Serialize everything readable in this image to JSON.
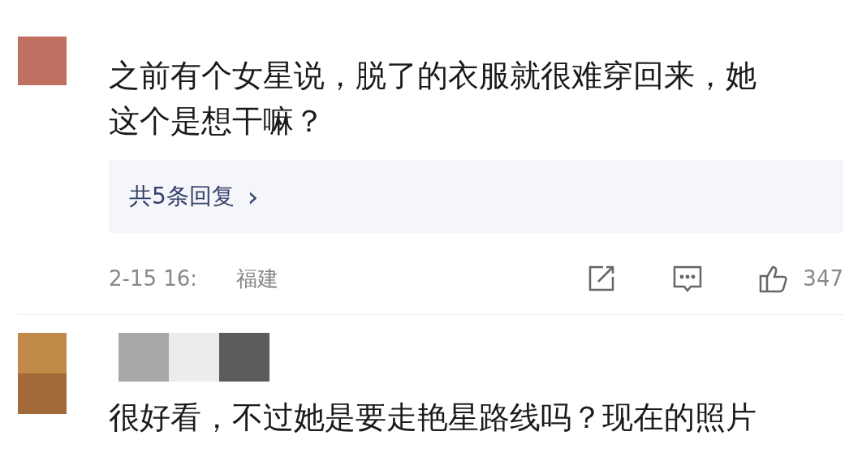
{
  "comments": [
    {
      "kind": "full",
      "color": "#c07060",
      "text": "之前有个女星说，脱了的衣服就很难穿回来，她这个是想干嘛？",
      "replies_link": "共5条回复",
      "replies_chevron": "›",
      "time": "2-15 16:",
      "location": "福建",
      "likes": "347"
    },
    {
      "kind": "partial",
      "color": "#c08a48",
      "text": "很好看，不过她是要走艳星路线吗？现在的照片"
    }
  ]
}
